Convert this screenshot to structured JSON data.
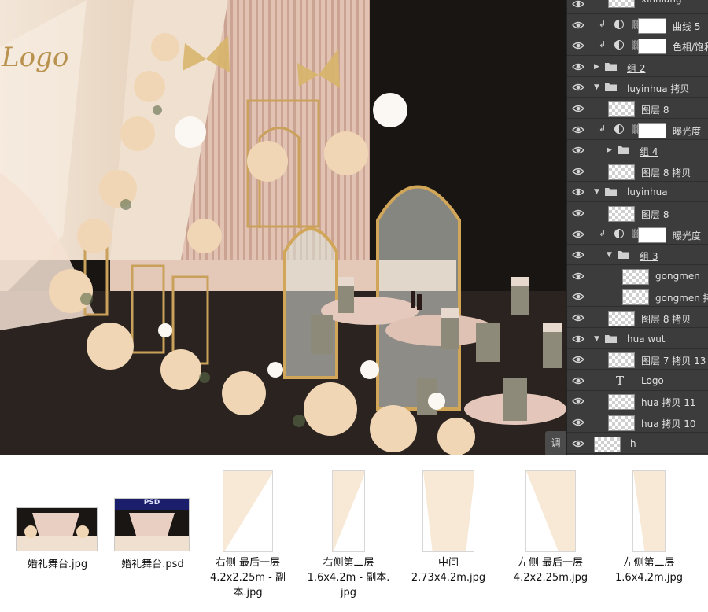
{
  "scene": {
    "logo": "Logo"
  },
  "layers": [
    {
      "type": "layer",
      "name": "xinniang"
    },
    {
      "type": "adjust",
      "name": "曲线 5"
    },
    {
      "type": "adjust",
      "name": "色相/饱和度"
    },
    {
      "type": "group",
      "name": "组 2",
      "expanded": false,
      "indent": 0
    },
    {
      "type": "group",
      "name": "luyinhua 拷贝",
      "expanded": true,
      "indent": 0
    },
    {
      "type": "layer",
      "name": "图层 8"
    },
    {
      "type": "adjust",
      "name": "曝光度"
    },
    {
      "type": "group",
      "name": "组 4",
      "expanded": false,
      "indent": 1
    },
    {
      "type": "layer",
      "name": "图层 8 拷贝"
    },
    {
      "type": "group",
      "name": "luyinhua",
      "expanded": true,
      "indent": 0
    },
    {
      "type": "layer",
      "name": "图层 8"
    },
    {
      "type": "adjust",
      "name": "曝光度"
    },
    {
      "type": "group",
      "name": "组 3",
      "expanded": true,
      "indent": 1
    },
    {
      "type": "layer",
      "name": "gongmen"
    },
    {
      "type": "layer",
      "name": "gongmen 拷贝"
    },
    {
      "type": "layer",
      "name": "图层 8 拷贝"
    },
    {
      "type": "group",
      "name": "hua wut",
      "expanded": true,
      "indent": 0
    },
    {
      "type": "layer",
      "name": "图层 7 拷贝 13"
    },
    {
      "type": "text",
      "name": "Logo"
    },
    {
      "type": "layer",
      "name": "hua 拷贝 11"
    },
    {
      "type": "layer",
      "name": "hua 拷贝 10"
    },
    {
      "type": "layer",
      "name": "h"
    }
  ],
  "adjust_tab": "调",
  "files": [
    {
      "name_lines": [
        "婚礼舞台.jpg"
      ],
      "kind": "jpg"
    },
    {
      "name_lines": [
        "婚礼舞台.psd"
      ],
      "kind": "psd",
      "badge": "PSD"
    },
    {
      "name_lines": [
        "右侧 最后一层",
        "4.2x2.25m - 副",
        "本.jpg"
      ],
      "kind": "panel"
    },
    {
      "name_lines": [
        "右侧第二层",
        "1.6x4.2m - 副本.",
        "jpg"
      ],
      "kind": "panel"
    },
    {
      "name_lines": [
        "中间",
        "2.73x4.2m.jpg"
      ],
      "kind": "panel"
    },
    {
      "name_lines": [
        "左侧 最后一层",
        "4.2x2.25m.jpg"
      ],
      "kind": "panel"
    },
    {
      "name_lines": [
        "左侧第二层",
        "1.6x4.2m.jpg"
      ],
      "kind": "panel"
    }
  ]
}
